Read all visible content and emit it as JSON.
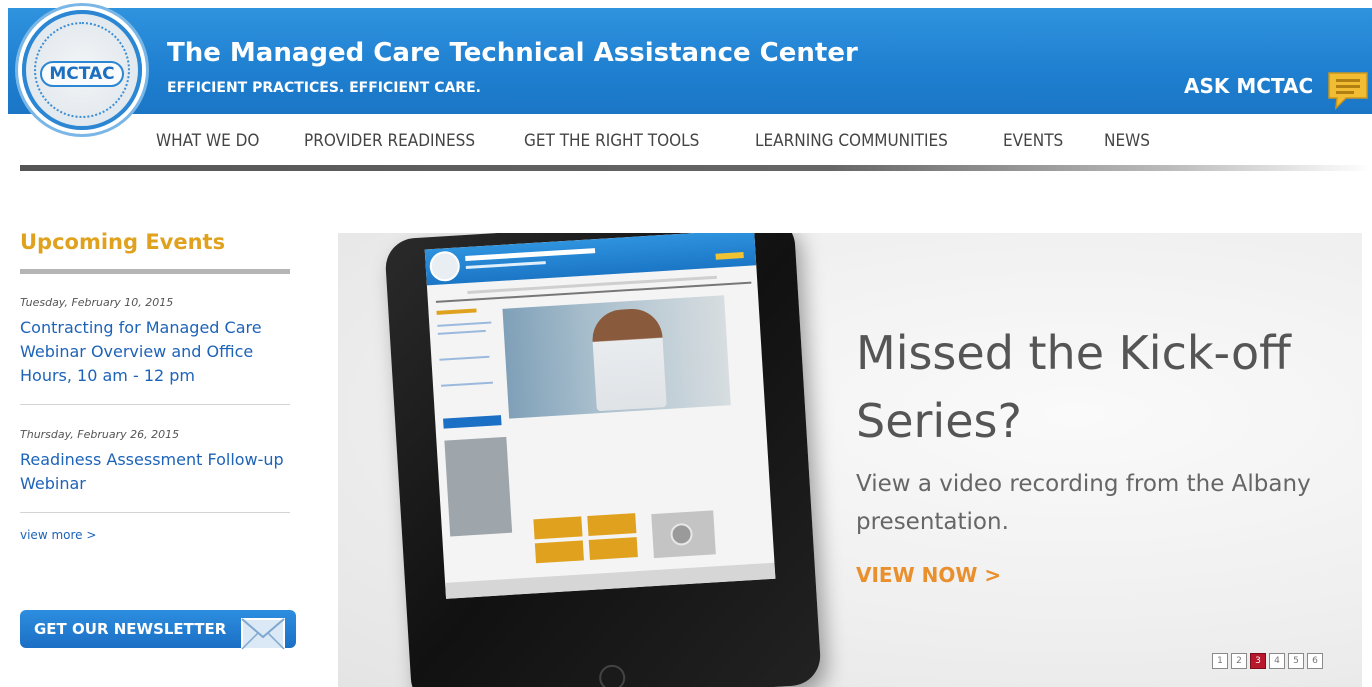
{
  "header": {
    "logo_text": "MCTAC",
    "title": "The Managed Care Technical Assistance Center",
    "tagline": "EFFICIENT PRACTICES. EFFICIENT CARE.",
    "ask_label": "ASK MCTAC",
    "banner_color": "#1f7fd0",
    "accent_color": "#e0a21e"
  },
  "nav": {
    "items": [
      {
        "label": "WHAT WE DO"
      },
      {
        "label": "PROVIDER READINESS"
      },
      {
        "label": "GET THE RIGHT TOOLS"
      },
      {
        "label": "LEARNING COMMUNITIES"
      },
      {
        "label": "EVENTS"
      },
      {
        "label": "NEWS"
      }
    ]
  },
  "sidebar": {
    "title": "Upcoming Events",
    "events": [
      {
        "date": "Tuesday, February 10, 2015",
        "title": "Contracting for Managed Care Webinar Overview and Office Hours, 10 am - 12 pm"
      },
      {
        "date": "Thursday, February 26, 2015",
        "title": "Readiness Assessment Follow-up Webinar"
      }
    ],
    "view_more": "view more >",
    "newsletter_label": "GET OUR NEWSLETTER"
  },
  "hero": {
    "headline": "Missed the Kick-off Series?",
    "subtext": "View a video recording from the Albany presentation.",
    "cta": "VIEW NOW >",
    "cta_color": "#e98f2c",
    "pager": {
      "pages": [
        "1",
        "2",
        "3",
        "4",
        "5",
        "6"
      ],
      "active_page": "3",
      "active_color": "#b8182b"
    }
  }
}
